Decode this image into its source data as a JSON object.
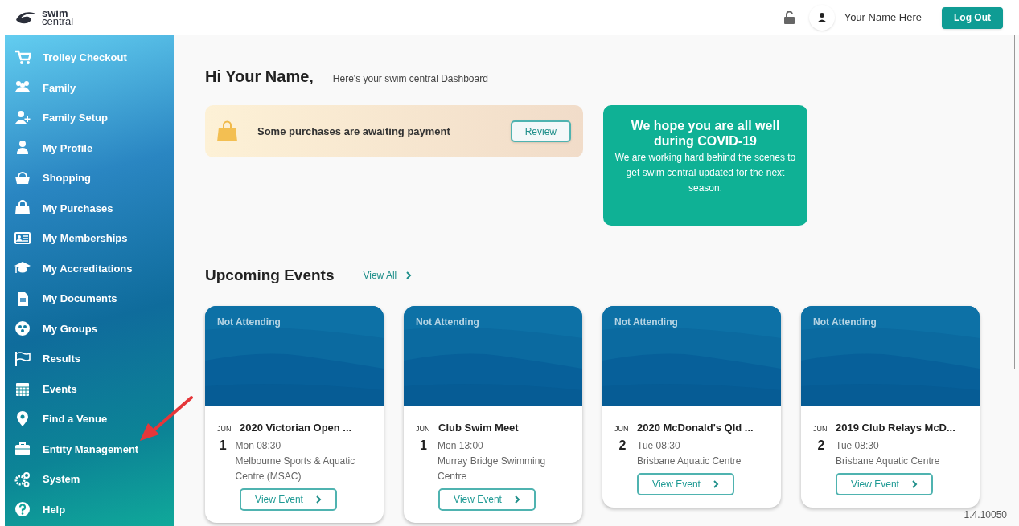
{
  "header": {
    "logo_top": "swim",
    "logo_bottom": "central",
    "user_name": "Your Name Here",
    "logout": "Log Out"
  },
  "sidebar": {
    "items": [
      {
        "label": "Trolley Checkout"
      },
      {
        "label": "Family"
      },
      {
        "label": "Family Setup"
      },
      {
        "label": "My Profile"
      },
      {
        "label": "Shopping"
      },
      {
        "label": "My Purchases"
      },
      {
        "label": "My Memberships"
      },
      {
        "label": "My Accreditations"
      },
      {
        "label": "My Documents"
      },
      {
        "label": "My Groups"
      },
      {
        "label": "Results"
      },
      {
        "label": "Events"
      },
      {
        "label": "Find a Venue"
      },
      {
        "label": "Entity Management"
      },
      {
        "label": "System"
      },
      {
        "label": "Help"
      }
    ]
  },
  "greeting": {
    "title": "Hi Your Name,",
    "subtitle": "Here's your swim central Dashboard"
  },
  "payment_notice": {
    "text": "Some purchases are awaiting payment",
    "button": "Review"
  },
  "covid_notice": {
    "title": "We hope you are all well during COVID-19",
    "body": "We are working hard behind the scenes to get swim central updated for the next season."
  },
  "events": {
    "title": "Upcoming Events",
    "view_all": "View All",
    "cards": [
      {
        "status": "Not Attending",
        "month": "JUN",
        "day": "1",
        "name": "2020 Victorian Open ...",
        "time": "Mon 08:30",
        "venue": "Melbourne Sports & Aquatic Centre (MSAC)",
        "button": "View Event"
      },
      {
        "status": "Not Attending",
        "month": "JUN",
        "day": "1",
        "name": "Club Swim Meet",
        "time": "Mon 13:00",
        "venue": "Murray Bridge Swimming Centre",
        "button": "View Event"
      },
      {
        "status": "Not Attending",
        "month": "JUN",
        "day": "2",
        "name": "2020 McDonald's Qld ...",
        "time": "Tue 08:30",
        "venue": "Brisbane Aquatic Centre",
        "button": "View Event"
      },
      {
        "status": "Not Attending",
        "month": "JUN",
        "day": "2",
        "name": "2019 Club Relays McD...",
        "time": "Tue 08:30",
        "venue": "Brisbane Aquatic Centre",
        "button": "View Event"
      }
    ]
  },
  "version": "1.4.10050"
}
